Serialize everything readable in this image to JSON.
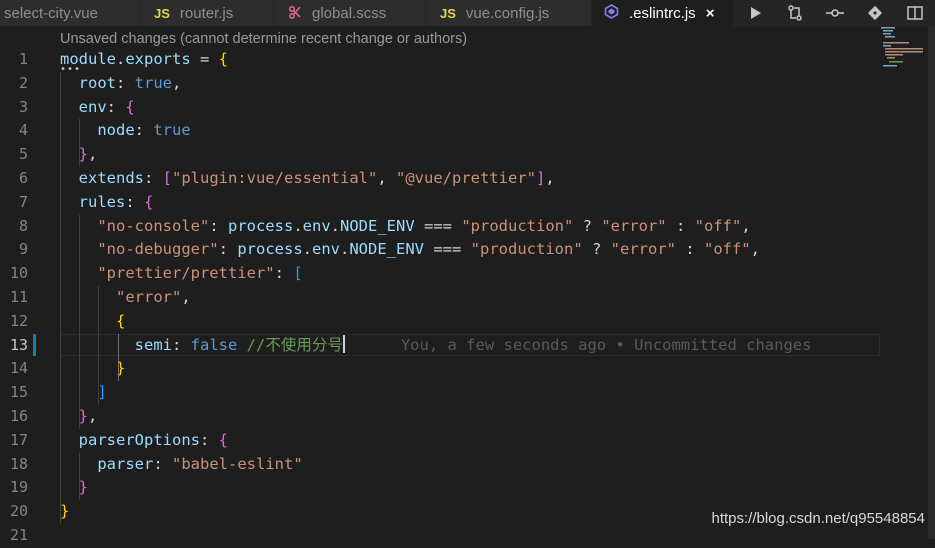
{
  "tabs": [
    {
      "label": "select-city.vue",
      "icon": "",
      "active": false
    },
    {
      "label": "router.js",
      "icon": "JS",
      "active": false
    },
    {
      "label": "global.scss",
      "icon": "scss-icon",
      "active": false
    },
    {
      "label": "vue.config.js",
      "icon": "JS",
      "active": false
    },
    {
      "label": ".eslintrc.js",
      "icon": "eslint-icon",
      "active": true,
      "close": "×"
    }
  ],
  "actions": [
    "run-icon",
    "open-changes-icon",
    "compare-icon",
    "git-icon",
    "split-editor-icon"
  ],
  "hint": "Unsaved changes (cannot determine recent change or authors)",
  "line_numbers": [
    "1",
    "2",
    "3",
    "4",
    "5",
    "6",
    "7",
    "8",
    "9",
    "10",
    "11",
    "12",
    "13",
    "14",
    "15",
    "16",
    "17",
    "18",
    "19",
    "20",
    "21"
  ],
  "active_line": 13,
  "code": [
    [
      [
        "module",
        "k"
      ],
      [
        ".",
        "w"
      ],
      [
        "exports",
        "k"
      ],
      [
        " = ",
        "w"
      ],
      [
        "{",
        "y"
      ]
    ],
    [
      [
        "  root",
        "k"
      ],
      [
        ": ",
        "w"
      ],
      [
        "true",
        "b"
      ],
      [
        ",",
        "w"
      ]
    ],
    [
      [
        "  env",
        "k"
      ],
      [
        ": ",
        "w"
      ],
      [
        "{",
        "p"
      ]
    ],
    [
      [
        "    node",
        "k"
      ],
      [
        ": ",
        "w"
      ],
      [
        "true",
        "b"
      ]
    ],
    [
      [
        "  ",
        "w"
      ],
      [
        "}",
        "p"
      ],
      [
        ",",
        "w"
      ]
    ],
    [
      [
        "  extends",
        "k"
      ],
      [
        ": ",
        "w"
      ],
      [
        "[",
        "p"
      ],
      [
        "\"plugin:vue/essential\"",
        "s"
      ],
      [
        ", ",
        "w"
      ],
      [
        "\"@vue/prettier\"",
        "s"
      ],
      [
        "]",
        "p"
      ],
      [
        ",",
        "w"
      ]
    ],
    [
      [
        "  rules",
        "k"
      ],
      [
        ": ",
        "w"
      ],
      [
        "{",
        "p"
      ]
    ],
    [
      [
        "    ",
        "w"
      ],
      [
        "\"no-console\"",
        "s"
      ],
      [
        ": ",
        "w"
      ],
      [
        "process",
        "k"
      ],
      [
        ".",
        "w"
      ],
      [
        "env",
        "k"
      ],
      [
        ".",
        "w"
      ],
      [
        "NODE_ENV",
        "k"
      ],
      [
        " === ",
        "w"
      ],
      [
        "\"production\"",
        "s"
      ],
      [
        " ? ",
        "w"
      ],
      [
        "\"error\"",
        "s"
      ],
      [
        " : ",
        "w"
      ],
      [
        "\"off\"",
        "s"
      ],
      [
        ",",
        "w"
      ]
    ],
    [
      [
        "    ",
        "w"
      ],
      [
        "\"no-debugger\"",
        "s"
      ],
      [
        ": ",
        "w"
      ],
      [
        "process",
        "k"
      ],
      [
        ".",
        "w"
      ],
      [
        "env",
        "k"
      ],
      [
        ".",
        "w"
      ],
      [
        "NODE_ENV",
        "k"
      ],
      [
        " === ",
        "w"
      ],
      [
        "\"production\"",
        "s"
      ],
      [
        " ? ",
        "w"
      ],
      [
        "\"error\"",
        "s"
      ],
      [
        " : ",
        "w"
      ],
      [
        "\"off\"",
        "s"
      ],
      [
        ",",
        "w"
      ]
    ],
    [
      [
        "    ",
        "w"
      ],
      [
        "\"prettier/prettier\"",
        "s"
      ],
      [
        ": ",
        "w"
      ],
      [
        "[",
        "bl"
      ]
    ],
    [
      [
        "      ",
        "w"
      ],
      [
        "\"error\"",
        "s"
      ],
      [
        ",",
        "w"
      ]
    ],
    [
      [
        "      ",
        "w"
      ],
      [
        "{",
        "y"
      ]
    ],
    [
      [
        "        semi",
        "k"
      ],
      [
        ": ",
        "w"
      ],
      [
        "false",
        "b"
      ],
      [
        " ",
        "w"
      ],
      [
        "//不使用分号",
        "c"
      ]
    ],
    [
      [
        "      ",
        "w"
      ],
      [
        "}",
        "y"
      ]
    ],
    [
      [
        "    ",
        "w"
      ],
      [
        "]",
        "bl"
      ]
    ],
    [
      [
        "  ",
        "w"
      ],
      [
        "}",
        "p"
      ],
      [
        ",",
        "w"
      ]
    ],
    [
      [
        "  parserOptions",
        "k"
      ],
      [
        ": ",
        "w"
      ],
      [
        "{",
        "p"
      ]
    ],
    [
      [
        "    parser",
        "k"
      ],
      [
        ": ",
        "w"
      ],
      [
        "\"babel-eslint\"",
        "s"
      ]
    ],
    [
      [
        "  ",
        "w"
      ],
      [
        "}",
        "p"
      ]
    ],
    [
      [
        "",
        "w"
      ],
      [
        "}",
        "y"
      ]
    ],
    []
  ],
  "blame": "You, a few seconds ago • Uncommitted changes",
  "watermark": "https://blog.csdn.net/q95548854",
  "colors": {
    "keyword": "#9cdcfe",
    "string": "#ce9178",
    "boolean": "#569cd6",
    "comment": "#6a9955",
    "bracket_gold": "#ffd700",
    "bracket_orchid": "#da70d6",
    "bracket_blue": "#179fff",
    "background": "#1e1e1e"
  }
}
